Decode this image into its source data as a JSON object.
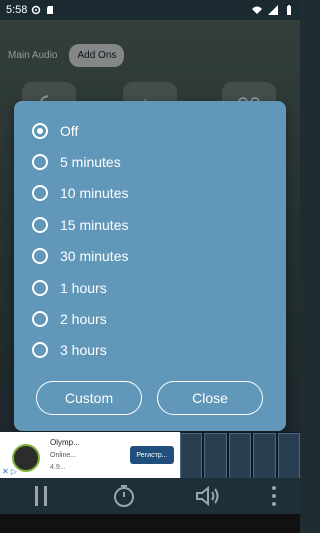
{
  "status_bar": {
    "time": "5:58"
  },
  "tabs": [
    {
      "label": "Main Audio"
    },
    {
      "label": "Add Ons"
    }
  ],
  "dialog": {
    "options": [
      {
        "label": "Off",
        "selected": true
      },
      {
        "label": "5 minutes",
        "selected": false
      },
      {
        "label": "10 minutes",
        "selected": false
      },
      {
        "label": "15 minutes",
        "selected": false
      },
      {
        "label": "30 minutes",
        "selected": false
      },
      {
        "label": "1 hours",
        "selected": false
      },
      {
        "label": "2 hours",
        "selected": false
      },
      {
        "label": "3 hours",
        "selected": false
      }
    ],
    "buttons": {
      "custom": "Custom",
      "close": "Close"
    }
  },
  "ad": {
    "title": "Olymp...",
    "subtitle": "Online...",
    "rating": "4.9...",
    "action": "Регистр..."
  },
  "colors": {
    "dialog": "#6198b9",
    "text": "#ffffff"
  }
}
